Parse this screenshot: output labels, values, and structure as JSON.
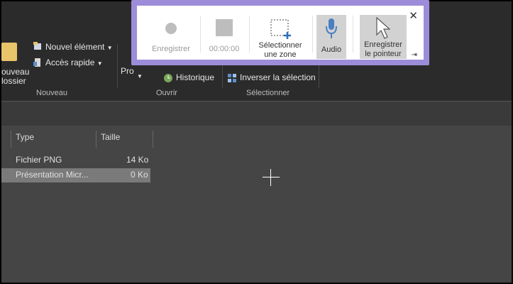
{
  "ribbon": {
    "new_folder_line1": "ouveau",
    "new_folder_line2": "lossier",
    "new_item": "Nouvel élément",
    "quick_access": "Accès rapide",
    "properties_partial": "Pro",
    "history": "Historique",
    "invert_selection": "Inverser la sélection",
    "groups": [
      "Nouveau",
      "Ouvrir",
      "Sélectionner"
    ]
  },
  "columns": [
    "Type",
    "Taille"
  ],
  "files": [
    {
      "type": "Fichier PNG",
      "size": "14 Ko"
    },
    {
      "type": "Présentation Micr...",
      "size": "0 Ko"
    }
  ],
  "recorder": {
    "record_label": "Enregistrer",
    "timer": "00:00:00",
    "select_area": [
      "Sélectionner",
      "une zone"
    ],
    "audio_label": "Audio",
    "pointer_label": [
      "Enregistrer",
      "le pointeur"
    ],
    "accent_color": "#9d8cd9",
    "mic_color": "#4a7fc1"
  }
}
